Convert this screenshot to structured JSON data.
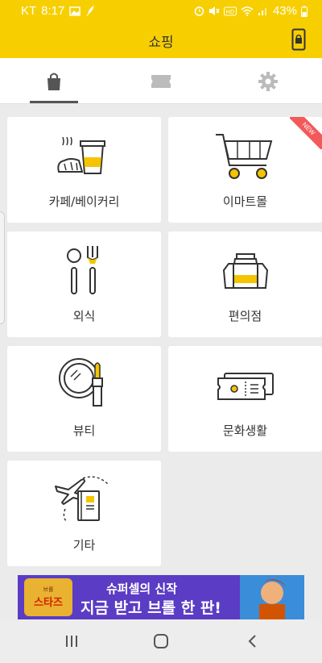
{
  "status_bar": {
    "carrier": "KT",
    "time": "8:17",
    "battery": "43%"
  },
  "app_bar": {
    "title": "쇼핑",
    "lock_icon": "phone-lock-icon"
  },
  "tabs": [
    {
      "name": "shopping-bag-tab",
      "icon": "shopping-bag-icon",
      "selected": true
    },
    {
      "name": "ticket-tab",
      "icon": "ticket-icon",
      "selected": false
    },
    {
      "name": "settings-tab",
      "icon": "gear-icon",
      "selected": false
    }
  ],
  "categories": [
    {
      "label": "카페/베이커리",
      "icon": "coffee-bread-icon"
    },
    {
      "label": "이마트몰",
      "icon": "shopping-cart-icon",
      "badge": "NEW"
    },
    {
      "label": "외식",
      "icon": "spoon-fork-icon"
    },
    {
      "label": "편의점",
      "icon": "jars-icon"
    },
    {
      "label": "뷰티",
      "icon": "mirror-lipstick-icon"
    },
    {
      "label": "문화생활",
      "icon": "ticket-icon"
    },
    {
      "label": "기타",
      "icon": "airplane-book-icon"
    }
  ],
  "ad": {
    "logo_sub": "브롤",
    "logo_main": "스타즈",
    "line1": "슈퍼셀의 신작",
    "line2": "지금 받고 브롤 한 판!"
  },
  "colors": {
    "accent": "#f7cf00",
    "new_badge": "#f25a5a",
    "icon_yellow": "#f5c400"
  }
}
